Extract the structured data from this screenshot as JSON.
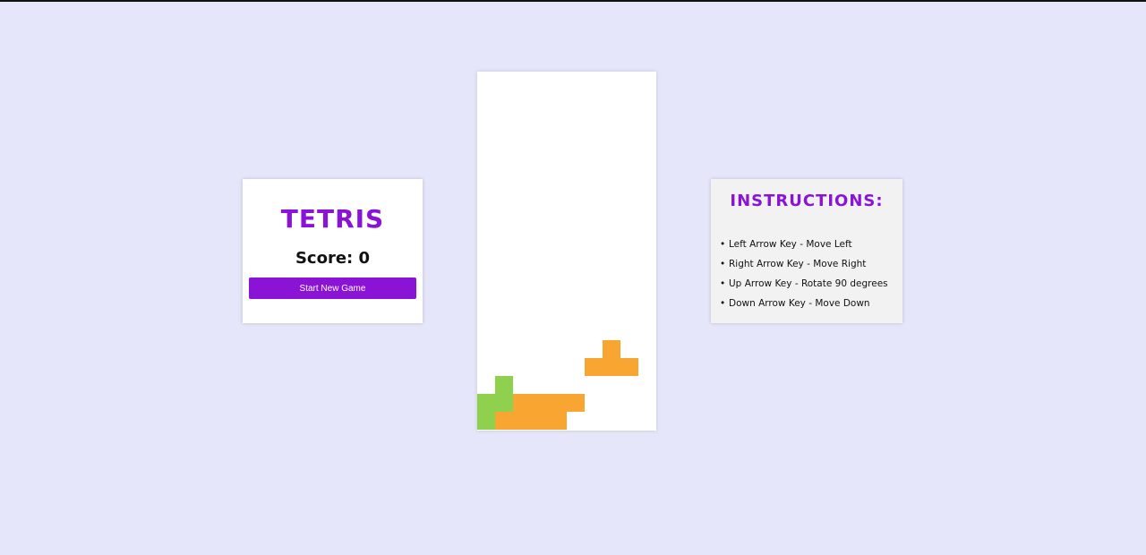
{
  "score_panel": {
    "title": "TETRIS",
    "score_label": "Score:",
    "score_value": "0",
    "start_button_label": "Start New Game"
  },
  "instructions": {
    "title": "INSTRUCTIONS:",
    "items": [
      "Left Arrow Key - Move Left",
      "Right Arrow Key - Move Right",
      "Up Arrow Key - Rotate 90 degrees",
      "Down Arrow Key - Move Down"
    ]
  },
  "board": {
    "columns": 10,
    "rows": 20,
    "locked_cells": [
      {
        "col": 1,
        "row": 17,
        "color": "green"
      },
      {
        "col": 0,
        "row": 18,
        "color": "green"
      },
      {
        "col": 1,
        "row": 18,
        "color": "green"
      },
      {
        "col": 0,
        "row": 19,
        "color": "green"
      },
      {
        "col": 2,
        "row": 18,
        "color": "orange"
      },
      {
        "col": 3,
        "row": 18,
        "color": "orange"
      },
      {
        "col": 4,
        "row": 18,
        "color": "orange"
      },
      {
        "col": 5,
        "row": 18,
        "color": "orange"
      },
      {
        "col": 1,
        "row": 19,
        "color": "orange"
      },
      {
        "col": 2,
        "row": 19,
        "color": "orange"
      },
      {
        "col": 3,
        "row": 19,
        "color": "orange"
      },
      {
        "col": 4,
        "row": 19,
        "color": "orange"
      }
    ],
    "falling_piece": {
      "color": "orange",
      "cells": [
        {
          "col": 7,
          "row": 15
        },
        {
          "col": 6,
          "row": 16
        },
        {
          "col": 7,
          "row": 16
        },
        {
          "col": 8,
          "row": 16
        }
      ]
    }
  },
  "colors": {
    "accent": "#8a13d6",
    "background": "#e6e6fa",
    "green": "#8fd14f",
    "orange": "#f8a532"
  }
}
